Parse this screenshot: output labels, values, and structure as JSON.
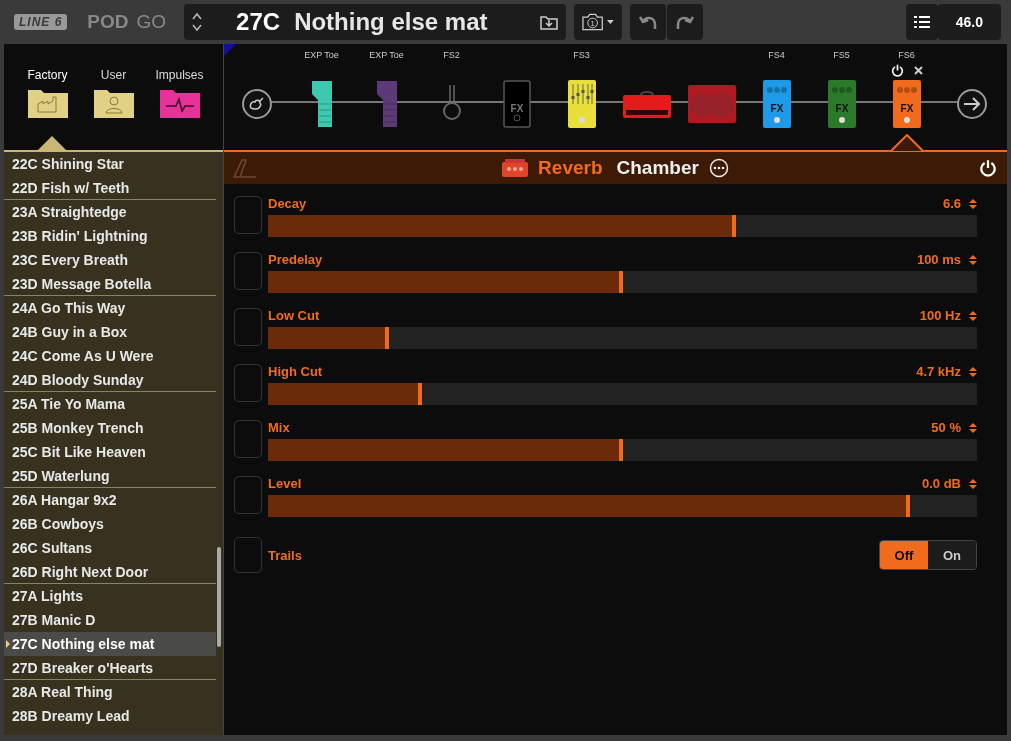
{
  "header": {
    "logo": "LINE 6",
    "product": "POD",
    "product_suffix": "GO",
    "preset_number": "27C",
    "preset_name": "Nothing else mat",
    "snapshot": "1",
    "tempo": "46.0"
  },
  "library_tabs": [
    {
      "label": "Factory",
      "selected": true,
      "kind": "factory"
    },
    {
      "label": "User",
      "selected": false,
      "kind": "user"
    },
    {
      "label": "Impulses",
      "selected": false,
      "kind": "impulse"
    }
  ],
  "presets": [
    {
      "number": "22C",
      "name": "Shining Star",
      "selected": false
    },
    {
      "number": "22D",
      "name": "Fish w/ Teeth",
      "selected": false
    },
    {
      "number": "23A",
      "name": "Straightedge",
      "selected": false
    },
    {
      "number": "23B",
      "name": "Ridin' Lightning",
      "selected": false
    },
    {
      "number": "23C",
      "name": "Every Breath",
      "selected": false
    },
    {
      "number": "23D",
      "name": "Message Botella",
      "selected": false
    },
    {
      "number": "24A",
      "name": "Go This Way",
      "selected": false
    },
    {
      "number": "24B",
      "name": "Guy in a Box",
      "selected": false
    },
    {
      "number": "24C",
      "name": "Come As U Were",
      "selected": false
    },
    {
      "number": "24D",
      "name": "Bloody Sunday",
      "selected": false
    },
    {
      "number": "25A",
      "name": "Tie Yo Mama",
      "selected": false
    },
    {
      "number": "25B",
      "name": "Monkey Trench",
      "selected": false
    },
    {
      "number": "25C",
      "name": "Bit Like Heaven",
      "selected": false
    },
    {
      "number": "25D",
      "name": "Waterlung",
      "selected": false
    },
    {
      "number": "26A",
      "name": "Hangar 9x2",
      "selected": false
    },
    {
      "number": "26B",
      "name": "Cowboys",
      "selected": false
    },
    {
      "number": "26C",
      "name": "Sultans",
      "selected": false
    },
    {
      "number": "26D",
      "name": "Right Next Door",
      "selected": false
    },
    {
      "number": "27A",
      "name": "Lights",
      "selected": false
    },
    {
      "number": "27B",
      "name": "Manic D",
      "selected": false
    },
    {
      "number": "27C",
      "name": "Nothing else mat",
      "selected": true
    },
    {
      "number": "27D",
      "name": "Breaker o'Hearts",
      "selected": false
    },
    {
      "number": "28A",
      "name": "Real Thing",
      "selected": false
    },
    {
      "number": "28B",
      "name": "Dreamy Lead",
      "selected": false
    }
  ],
  "chain": [
    {
      "kind": "input",
      "selected": false
    },
    {
      "kind": "expression",
      "label": "EXP Toe",
      "color": "#3cc9b0",
      "selected": false
    },
    {
      "kind": "expression",
      "label": "EXP Toe",
      "color": "#5c3a78",
      "selected": false
    },
    {
      "kind": "switch",
      "label": "FS2",
      "selected": false
    },
    {
      "kind": "empty",
      "fx": "FX",
      "selected": false
    },
    {
      "kind": "eq",
      "label": "FS3",
      "color": "#e8df3a",
      "selected": false
    },
    {
      "kind": "amp",
      "selected": false
    },
    {
      "kind": "cab",
      "selected": false
    },
    {
      "kind": "pedal",
      "label": "FS4",
      "color": "#1e9be8",
      "fx": "FX",
      "selected": false
    },
    {
      "kind": "pedal",
      "label": "FS5",
      "color": "#2b7a2b",
      "fx": "FX",
      "selected": false
    },
    {
      "kind": "pedal",
      "label": "FS6",
      "color": "#f26b1d",
      "fx": "FX",
      "selected": true
    },
    {
      "kind": "output",
      "selected": false
    }
  ],
  "block": {
    "category": "Reverb",
    "model": "Chamber",
    "on": true
  },
  "params": [
    {
      "kind": "slider",
      "name": "Decay",
      "value": "6.6",
      "level": 0.66
    },
    {
      "kind": "slider",
      "name": "Predelay",
      "value": "100 ms",
      "level": 0.5
    },
    {
      "kind": "slider",
      "name": "Low Cut",
      "value": "100 Hz",
      "level": 0.17
    },
    {
      "kind": "slider",
      "name": "High Cut",
      "value": "4.7 kHz",
      "level": 0.217
    },
    {
      "kind": "slider",
      "name": "Mix",
      "value": "50 %",
      "level": 0.5
    },
    {
      "kind": "slider",
      "name": "Level",
      "value": "0.0 dB",
      "level": 0.905
    },
    {
      "kind": "toggle",
      "name": "Trails",
      "options": [
        {
          "label": "Off",
          "selected": true
        },
        {
          "label": "On",
          "selected": false
        }
      ]
    }
  ]
}
